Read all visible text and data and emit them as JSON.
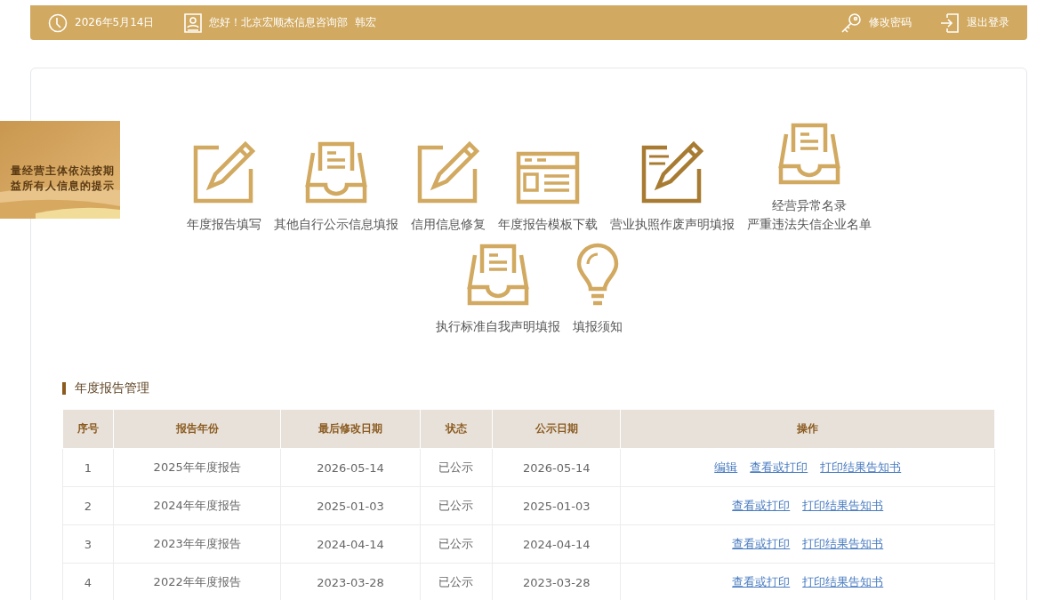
{
  "header": {
    "date": "2026年5月14日",
    "greeting": "您好！北京宏顺杰信息咨询部  韩宏",
    "actions": [
      {
        "kind": "key",
        "label": "修改密码"
      },
      {
        "kind": "logout",
        "label": "退出登录"
      }
    ]
  },
  "banner": {
    "lines": [
      "量经营主体依法按期",
      "益所有人信息的提示"
    ]
  },
  "services": [
    {
      "kind": "edit",
      "labels": [
        "年度报告填写"
      ]
    },
    {
      "kind": "inbox",
      "labels": [
        "其他自行公示信息填报"
      ]
    },
    {
      "kind": "edit",
      "labels": [
        "信用信息修复"
      ]
    },
    {
      "kind": "template",
      "labels": [
        "年度报告模板下载"
      ]
    },
    {
      "kind": "edit-dark",
      "labels": [
        "营业执照作废声明填报"
      ]
    },
    {
      "kind": "inbox",
      "labels": [
        "经营异常名录",
        "严重违法失信企业名单"
      ]
    },
    {
      "kind": "inbox",
      "labels": [
        "执行标准自我声明填报"
      ]
    },
    {
      "kind": "bulb",
      "labels": [
        "填报须知"
      ]
    }
  ],
  "section_title": "年度报告管理",
  "table": {
    "columns": [
      "序号",
      "报告年份",
      "最后修改日期",
      "状态",
      "公示日期",
      "操作"
    ],
    "rows": [
      {
        "cells": [
          "1",
          "2025年年度报告",
          "2026-05-14",
          "已公示",
          "2026-05-14"
        ],
        "actions": [
          "编辑",
          "查看或打印",
          "打印结果告知书"
        ]
      },
      {
        "cells": [
          "2",
          "2024年年度报告",
          "2025-01-03",
          "已公示",
          "2025-01-03"
        ],
        "actions": [
          "查看或打印",
          "打印结果告知书"
        ]
      },
      {
        "cells": [
          "3",
          "2023年年度报告",
          "2024-04-14",
          "已公示",
          "2024-04-14"
        ],
        "actions": [
          "查看或打印",
          "打印结果告知书"
        ]
      },
      {
        "cells": [
          "4",
          "2022年年度报告",
          "2023-03-28",
          "已公示",
          "2023-03-28"
        ],
        "actions": [
          "查看或打印",
          "打印结果告知书"
        ]
      }
    ]
  }
}
